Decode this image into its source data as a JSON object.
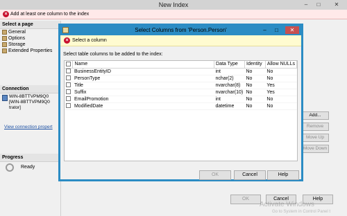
{
  "window": {
    "title": "New Index",
    "error_banner": "Add at least one column to the index"
  },
  "left_panel": {
    "select_page_heading": "Select a page",
    "pages": [
      "General",
      "Options",
      "Storage",
      "Extended Properties"
    ],
    "connection_heading": "Connection",
    "connection_lines": [
      "WIN-8BTTVPM9Q0",
      "[WIN-8BTTVPM9Q0",
      "trator]"
    ],
    "view_connection_link": "View connection propert",
    "progress_heading": "Progress",
    "progress_status": "Ready"
  },
  "side_buttons": {
    "add": "Add...",
    "remove": "Remove",
    "move_up": "Move Up",
    "move_down": "Move Down"
  },
  "bottom_buttons": {
    "ok": "OK",
    "cancel": "Cancel",
    "help": "Help"
  },
  "watermark": {
    "line1": "Activate Windows",
    "line2": "Go to System in Control Panel t"
  },
  "dialog": {
    "title": "Select Columns from 'Person.Person'",
    "banner": "Select a column",
    "instruction": "Select table columns to be added to the index:",
    "columns": {
      "name": "Name",
      "data_type": "Data Type",
      "identity": "Identity",
      "allow_nulls": "Allow NULLs"
    },
    "rows": [
      {
        "name": "BusinessEntityID",
        "data_type": "int",
        "identity": "No",
        "allow_nulls": "No"
      },
      {
        "name": "PersonType",
        "data_type": "nchar(2)",
        "identity": "No",
        "allow_nulls": "No"
      },
      {
        "name": "Title",
        "data_type": "nvarchar(8)",
        "identity": "No",
        "allow_nulls": "Yes"
      },
      {
        "name": "Suffix",
        "data_type": "nvarchar(10)",
        "identity": "No",
        "allow_nulls": "Yes"
      },
      {
        "name": "EmailPromotion",
        "data_type": "int",
        "identity": "No",
        "allow_nulls": "No"
      },
      {
        "name": "ModifiedDate",
        "data_type": "datetime",
        "identity": "No",
        "allow_nulls": "No"
      }
    ],
    "buttons": {
      "ok": "OK",
      "cancel": "Cancel",
      "help": "Help"
    }
  }
}
